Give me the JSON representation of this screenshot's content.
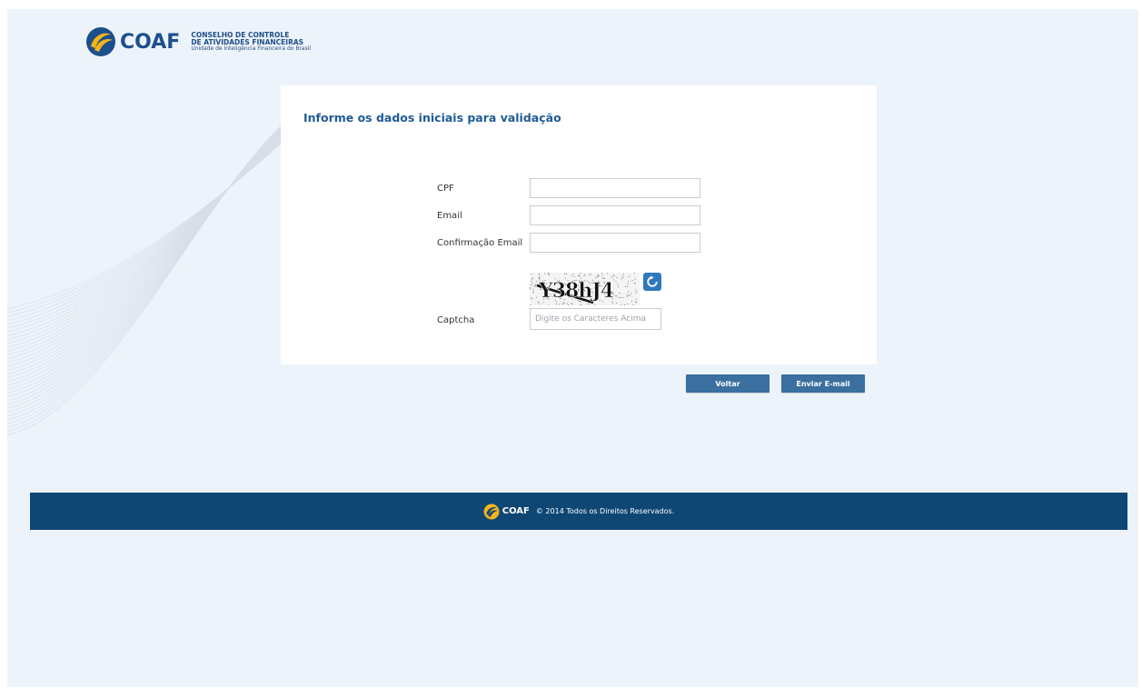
{
  "header": {
    "brand": "COAF",
    "line1": "CONSELHO DE CONTROLE",
    "line2": "DE ATIVIDADES FINANCEIRAS",
    "line3": "Unidade de Inteligência Financeira do Brasil"
  },
  "form": {
    "title": "Informe os dados iniciais para validação",
    "fields": [
      {
        "label": "CPF",
        "value": "",
        "placeholder": ""
      },
      {
        "label": "Email",
        "value": "",
        "placeholder": ""
      },
      {
        "label": "Confirmação Email",
        "value": "",
        "placeholder": ""
      }
    ],
    "captcha": {
      "label": "Captcha",
      "image_text": "Y38hJ4",
      "placeholder": "Digite os Caracteres Acima",
      "value": "",
      "refresh_icon": "refresh-icon"
    }
  },
  "buttons": {
    "back": "Voltar",
    "send": "Enviar E-mail"
  },
  "footer": {
    "brand": "COAF",
    "copyright": "© 2014 Todos os Direitos Reservados."
  },
  "colors": {
    "background": "#edf3fa",
    "brand_blue": "#1d4f8c",
    "title_blue": "#1f5b97",
    "button": "#3a6f9f",
    "footer": "#0e4774",
    "accent_yellow": "#f2b51a"
  }
}
